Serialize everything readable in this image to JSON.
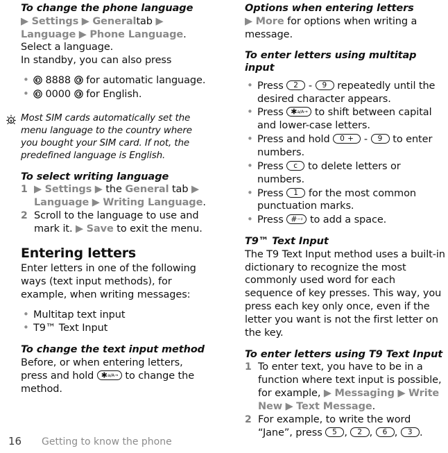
{
  "document": {
    "type": "mobile-phone-user-guide-page",
    "page_number": "16",
    "chapter": "Getting to know the phone"
  },
  "left_column": {
    "heading_change_language": "To change the phone language",
    "path_line_1_pre": "",
    "path_settings": "Settings",
    "path_general": "General",
    "path_tab_word": "tab",
    "path_language": "Language",
    "path_phone_language": "Phone Language",
    "path_select_a_language": ". Select a language.",
    "standby_text": "In standby, you can also press",
    "standby_bullets": [
      {
        "digits": "8888",
        "text": "for automatic language."
      },
      {
        "digits": "0000",
        "text": "for English."
      }
    ],
    "tip_text": "Most SIM cards automatically set the menu language to the country where you bought your SIM card. If not, the predefined language is English.",
    "tip_icon": "lightbulb-icon",
    "heading_writing_language": "To select writing language",
    "writing_steps": [
      {
        "pre": "",
        "settings": "Settings",
        "the_word": "the",
        "general": "General",
        "tab_word": "tab",
        "language": "Language",
        "writing_language": "Writing Language",
        "suffix": "."
      },
      {
        "text_a": "Scroll to the language to use and mark it.",
        "save": "Save",
        "text_b": "to exit the menu."
      }
    ],
    "heading_entering_letters": "Entering letters",
    "entering_letters_body": "Enter letters in one of the following ways (text input methods), for example, when writing messages:",
    "input_methods": [
      "Multitap text input",
      "T9™ Text Input"
    ],
    "heading_change_input_method": "To change the text input method",
    "change_input_method_pre": "Before, or when entering letters, press and hold",
    "change_input_method_post": "to change the method."
  },
  "right_column": {
    "heading_options": "Options when entering letters",
    "options_more": "More",
    "options_text": "for options when writing a message.",
    "heading_multitap": "To enter letters using multitap input",
    "multitap_bullets": [
      {
        "pre": "Press",
        "key_a": "2",
        "sep": "-",
        "key_b": "9",
        "post": "repeatedly until the desired character appears."
      },
      {
        "pre": "Press",
        "key_star": "star",
        "post": "to shift between capital and lower-case letters."
      },
      {
        "pre": "Press and hold",
        "key_a": "0 +",
        "sep": "-",
        "key_b": "9",
        "post": "to enter numbers."
      },
      {
        "pre": "Press",
        "key_a": "c",
        "post": "to delete letters or numbers."
      },
      {
        "pre": "Press",
        "key_a": "1",
        "post": "for the most common punctuation marks."
      },
      {
        "pre": "Press",
        "key_hash": "hash",
        "post": "to add a space."
      }
    ],
    "heading_t9": "T9™ Text Input",
    "t9_body": "The T9 Text Input method uses a built-in dictionary to recognize the most commonly used word for each sequence of key presses. This way, you press each key only once, even if the letter you want is not the first letter on the key.",
    "heading_t9_enter": "To enter letters using T9 Text Input",
    "t9_steps": [
      {
        "text_a": "To enter text, you have to be in a function where text input is possible, for example,",
        "messaging": "Messaging",
        "write_new": "Write New",
        "text_message": "Text Message",
        "suffix": "."
      },
      {
        "text_a": "For example, to write the word “Jane”, press",
        "keys": [
          "5",
          "2",
          "6",
          "3"
        ],
        "suffix": "."
      }
    ]
  },
  "colors": {
    "menu_path": "#898989",
    "body_text": "#111111",
    "step_number": "#7d7d7d",
    "footer_chapter": "#8c8c8c",
    "footer_pageno": "#3a3a3a"
  }
}
